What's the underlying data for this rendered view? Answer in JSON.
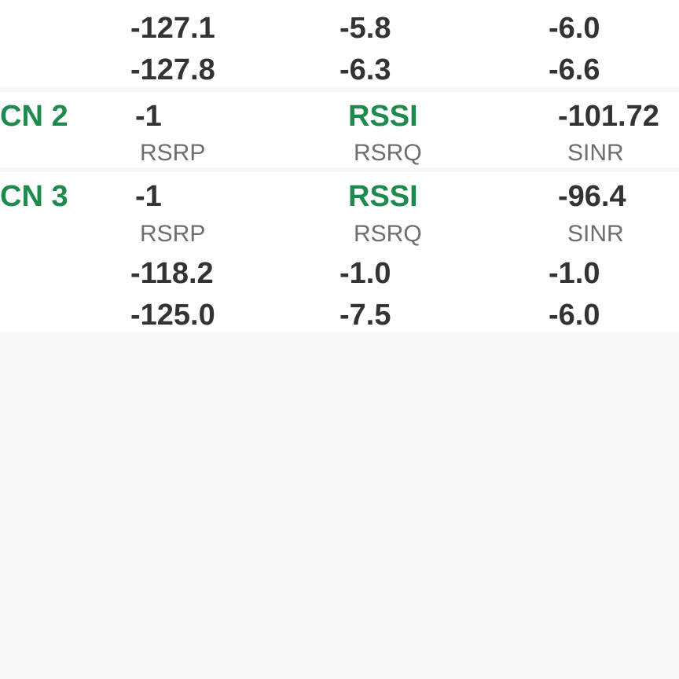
{
  "colors": {
    "accent_green": "#1e8a4e",
    "value_text": "#333333",
    "label_text": "#6e6e6e",
    "background": "#f8f8f8",
    "card": "#ffffff"
  },
  "top_block": {
    "rows": [
      [
        "-127.1",
        "-5.8",
        "-6.0"
      ],
      [
        "-127.8",
        "-6.3",
        "-6.6"
      ]
    ]
  },
  "cn2": {
    "name": "CN 2",
    "first_value": "-1",
    "rssi_label": "RSSI",
    "rssi_value": "-101.72",
    "labels": [
      "RSRP",
      "RSRQ",
      "SINR"
    ]
  },
  "cn3": {
    "name": "CN 3",
    "first_value": "-1",
    "rssi_label": "RSSI",
    "rssi_value": "-96.4",
    "labels": [
      "RSRP",
      "RSRQ",
      "SINR"
    ],
    "rows": [
      [
        "-118.2",
        "-1.0",
        "-1.0"
      ],
      [
        "-125.0",
        "-7.5",
        "-6.0"
      ]
    ]
  }
}
